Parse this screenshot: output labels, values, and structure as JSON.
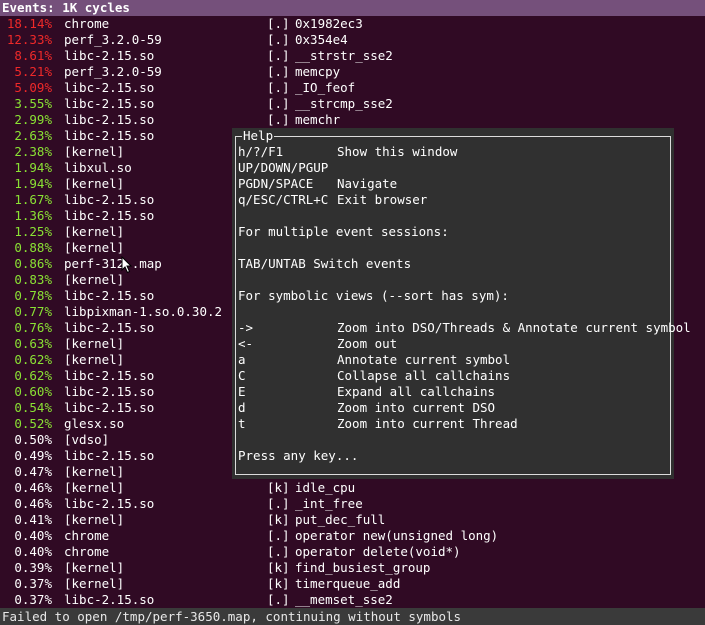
{
  "header": {
    "title": "Events: 1K cycles"
  },
  "colors": {
    "titlebar_bg": "#75507b",
    "background": "#300a24",
    "pct_red": "#ef2929",
    "pct_green": "#8ae234",
    "pct_white": "#ffffff",
    "popup_bg": "#303030",
    "status_bg": "#3a3a3a"
  },
  "rows": [
    {
      "pct": "18.14%",
      "cmd": "chrome",
      "lvl": "[.]",
      "sym": "0x1982ec3",
      "color": "#ef2929"
    },
    {
      "pct": "12.33%",
      "cmd": "perf_3.2.0-59",
      "lvl": "[.]",
      "sym": "0x354e4",
      "color": "#ef2929"
    },
    {
      "pct": "8.61%",
      "cmd": "libc-2.15.so",
      "lvl": "[.]",
      "sym": "__strstr_sse2",
      "color": "#ef2929"
    },
    {
      "pct": "5.21%",
      "cmd": "perf_3.2.0-59",
      "lvl": "[.]",
      "sym": "memcpy",
      "color": "#ef2929"
    },
    {
      "pct": "5.09%",
      "cmd": "libc-2.15.so",
      "lvl": "[.]",
      "sym": "_IO_feof",
      "color": "#ef2929"
    },
    {
      "pct": "3.55%",
      "cmd": "libc-2.15.so",
      "lvl": "[.]",
      "sym": "__strcmp_sse2",
      "color": "#8ae234"
    },
    {
      "pct": "2.99%",
      "cmd": "libc-2.15.so",
      "lvl": "[.]",
      "sym": "memchr",
      "color": "#8ae234"
    },
    {
      "pct": "2.63%",
      "cmd": "libc-2.15.so",
      "lvl": "",
      "sym": "",
      "color": "#8ae234"
    },
    {
      "pct": "2.38%",
      "cmd": "[kernel]",
      "lvl": "",
      "sym": "",
      "color": "#8ae234"
    },
    {
      "pct": "1.94%",
      "cmd": "libxul.so",
      "lvl": "",
      "sym": "",
      "color": "#8ae234"
    },
    {
      "pct": "1.94%",
      "cmd": "[kernel]",
      "lvl": "",
      "sym": "",
      "color": "#8ae234"
    },
    {
      "pct": "1.67%",
      "cmd": "libc-2.15.so",
      "lvl": "",
      "sym": "",
      "color": "#8ae234"
    },
    {
      "pct": "1.36%",
      "cmd": "libc-2.15.so",
      "lvl": "",
      "sym": "",
      "color": "#8ae234"
    },
    {
      "pct": "1.25%",
      "cmd": "[kernel]",
      "lvl": "",
      "sym": "",
      "color": "#8ae234"
    },
    {
      "pct": "0.88%",
      "cmd": "[kernel]",
      "lvl": "",
      "sym": "",
      "color": "#8ae234"
    },
    {
      "pct": "0.86%",
      "cmd": "perf-312 .map",
      "lvl": "",
      "sym": "",
      "color": "#8ae234"
    },
    {
      "pct": "0.83%",
      "cmd": "[kernel]",
      "lvl": "",
      "sym": "",
      "color": "#8ae234"
    },
    {
      "pct": "0.78%",
      "cmd": "libc-2.15.so",
      "lvl": "",
      "sym": "",
      "color": "#8ae234"
    },
    {
      "pct": "0.77%",
      "cmd": "libpixman-1.so.0.30.2",
      "lvl": "",
      "sym": "",
      "color": "#8ae234"
    },
    {
      "pct": "0.76%",
      "cmd": "libc-2.15.so",
      "lvl": "",
      "sym": "",
      "color": "#8ae234"
    },
    {
      "pct": "0.63%",
      "cmd": "[kernel]",
      "lvl": "",
      "sym": "",
      "color": "#8ae234"
    },
    {
      "pct": "0.62%",
      "cmd": "[kernel]",
      "lvl": "",
      "sym": "",
      "color": "#8ae234"
    },
    {
      "pct": "0.62%",
      "cmd": "libc-2.15.so",
      "lvl": "",
      "sym": "",
      "color": "#8ae234"
    },
    {
      "pct": "0.60%",
      "cmd": "libc-2.15.so",
      "lvl": "",
      "sym": "",
      "color": "#8ae234"
    },
    {
      "pct": "0.54%",
      "cmd": "libc-2.15.so",
      "lvl": "",
      "sym": "",
      "color": "#8ae234"
    },
    {
      "pct": "0.52%",
      "cmd": "glesx.so",
      "lvl": "",
      "sym": "",
      "color": "#8ae234"
    },
    {
      "pct": "0.50%",
      "cmd": "[vdso]",
      "lvl": "",
      "sym": "",
      "color": "#ffffff"
    },
    {
      "pct": "0.49%",
      "cmd": "libc-2.15.so",
      "lvl": "",
      "sym": "",
      "color": "#ffffff"
    },
    {
      "pct": "0.47%",
      "cmd": "[kernel]",
      "lvl": "",
      "sym": "",
      "color": "#ffffff"
    },
    {
      "pct": "0.46%",
      "cmd": "[kernel]",
      "lvl": "[k]",
      "sym": "idle_cpu",
      "color": "#ffffff"
    },
    {
      "pct": "0.46%",
      "cmd": "libc-2.15.so",
      "lvl": "[.]",
      "sym": "_int_free",
      "color": "#ffffff"
    },
    {
      "pct": "0.41%",
      "cmd": "[kernel]",
      "lvl": "[k]",
      "sym": "put_dec_full",
      "color": "#ffffff"
    },
    {
      "pct": "0.40%",
      "cmd": "chrome",
      "lvl": "[.]",
      "sym": "operator new(unsigned long)",
      "color": "#ffffff"
    },
    {
      "pct": "0.40%",
      "cmd": "chrome",
      "lvl": "[.]",
      "sym": "operator delete(void*)",
      "color": "#ffffff"
    },
    {
      "pct": "0.39%",
      "cmd": "[kernel]",
      "lvl": "[k]",
      "sym": "find_busiest_group",
      "color": "#ffffff"
    },
    {
      "pct": "0.37%",
      "cmd": "[kernel]",
      "lvl": "[k]",
      "sym": "timerqueue_add",
      "color": "#ffffff"
    },
    {
      "pct": "0.37%",
      "cmd": "libc-2.15.so",
      "lvl": "[.]",
      "sym": "__memset_sse2",
      "color": "#ffffff"
    }
  ],
  "help": {
    "title": "Help",
    "lines": [
      {
        "k": "h/?/F1",
        "d": "Show this window"
      },
      {
        "k": "UP/DOWN/PGUP",
        "d": ""
      },
      {
        "k": "PGDN/SPACE",
        "d": "Navigate"
      },
      {
        "k": "q/ESC/CTRL+C",
        "d": "Exit browser"
      },
      {
        "k": "",
        "d": ""
      },
      {
        "k": "For multiple event sessions:",
        "d": ""
      },
      {
        "k": "",
        "d": ""
      },
      {
        "k": "TAB/UNTAB Switch events",
        "d": ""
      },
      {
        "k": "",
        "d": ""
      },
      {
        "k": "For symbolic views (--sort has sym):",
        "d": ""
      },
      {
        "k": "",
        "d": ""
      },
      {
        "k": "->",
        "d": "Zoom into DSO/Threads & Annotate current symbol"
      },
      {
        "k": "<-",
        "d": "Zoom out"
      },
      {
        "k": "a",
        "d": "Annotate current symbol"
      },
      {
        "k": "C",
        "d": "Collapse all callchains"
      },
      {
        "k": "E",
        "d": "Expand all callchains"
      },
      {
        "k": "d",
        "d": "Zoom into current DSO"
      },
      {
        "k": "t",
        "d": "Zoom into current Thread"
      },
      {
        "k": "",
        "d": ""
      },
      {
        "k": "Press any key...",
        "d": ""
      }
    ]
  },
  "status": {
    "message": "Failed to open /tmp/perf-3650.map, continuing without symbols"
  },
  "icons": {
    "cursor": "mouse-pointer-icon"
  }
}
